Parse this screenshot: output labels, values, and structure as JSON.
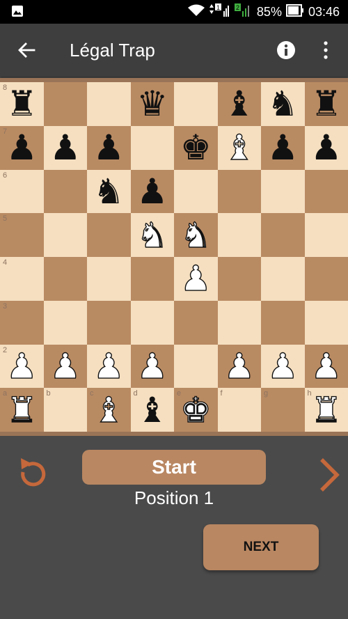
{
  "status_bar": {
    "battery": "85%",
    "time": "03:46",
    "sim1_badge": "1",
    "sim2_badge": "2",
    "icons": [
      "image-icon",
      "wifi-icon",
      "signal-icon",
      "battery-icon"
    ]
  },
  "app_bar": {
    "title": "Légal Trap",
    "back_icon": "arrow-back-icon",
    "info_icon": "info-icon",
    "more_icon": "more-vert-icon"
  },
  "board": {
    "colors": {
      "light": "#f5dfc0",
      "dark": "#b98b63",
      "accent": "#b98762"
    },
    "rank_labels": [
      "8",
      "7",
      "6",
      "5",
      "4",
      "3",
      "2"
    ],
    "file_labels": [
      "a",
      "b",
      "c",
      "d",
      "e",
      "f",
      "g",
      "h"
    ],
    "pieces": [
      {
        "square": "a8",
        "piece": "rook",
        "color": "black"
      },
      {
        "square": "d8",
        "piece": "queen",
        "color": "black"
      },
      {
        "square": "f8",
        "piece": "bishop",
        "color": "black"
      },
      {
        "square": "g8",
        "piece": "knight",
        "color": "black"
      },
      {
        "square": "h8",
        "piece": "rook",
        "color": "black"
      },
      {
        "square": "a7",
        "piece": "pawn",
        "color": "black"
      },
      {
        "square": "b7",
        "piece": "pawn",
        "color": "black"
      },
      {
        "square": "c7",
        "piece": "pawn",
        "color": "black"
      },
      {
        "square": "e7",
        "piece": "king",
        "color": "black"
      },
      {
        "square": "f7",
        "piece": "bishop",
        "color": "white"
      },
      {
        "square": "g7",
        "piece": "pawn",
        "color": "black"
      },
      {
        "square": "h7",
        "piece": "pawn",
        "color": "black"
      },
      {
        "square": "c6",
        "piece": "knight",
        "color": "black"
      },
      {
        "square": "d6",
        "piece": "pawn",
        "color": "black"
      },
      {
        "square": "d5",
        "piece": "knight",
        "color": "white"
      },
      {
        "square": "e5",
        "piece": "knight",
        "color": "white"
      },
      {
        "square": "e4",
        "piece": "pawn",
        "color": "white"
      },
      {
        "square": "a2",
        "piece": "pawn",
        "color": "white"
      },
      {
        "square": "b2",
        "piece": "pawn",
        "color": "white"
      },
      {
        "square": "c2",
        "piece": "pawn",
        "color": "white"
      },
      {
        "square": "d2",
        "piece": "pawn",
        "color": "white"
      },
      {
        "square": "f2",
        "piece": "pawn",
        "color": "white"
      },
      {
        "square": "g2",
        "piece": "pawn",
        "color": "white"
      },
      {
        "square": "h2",
        "piece": "pawn",
        "color": "white"
      },
      {
        "square": "a1",
        "piece": "rook",
        "color": "white"
      },
      {
        "square": "c1",
        "piece": "bishop",
        "color": "white"
      },
      {
        "square": "d1",
        "piece": "bishop",
        "color": "black"
      },
      {
        "square": "e1",
        "piece": "king",
        "color": "white"
      },
      {
        "square": "h1",
        "piece": "rook",
        "color": "white"
      }
    ]
  },
  "controls": {
    "reset_icon": "replay-icon",
    "next_arrow_icon": "chevron-right-icon",
    "start_label": "Start",
    "position_label": "Position 1",
    "next_label": "NEXT"
  }
}
